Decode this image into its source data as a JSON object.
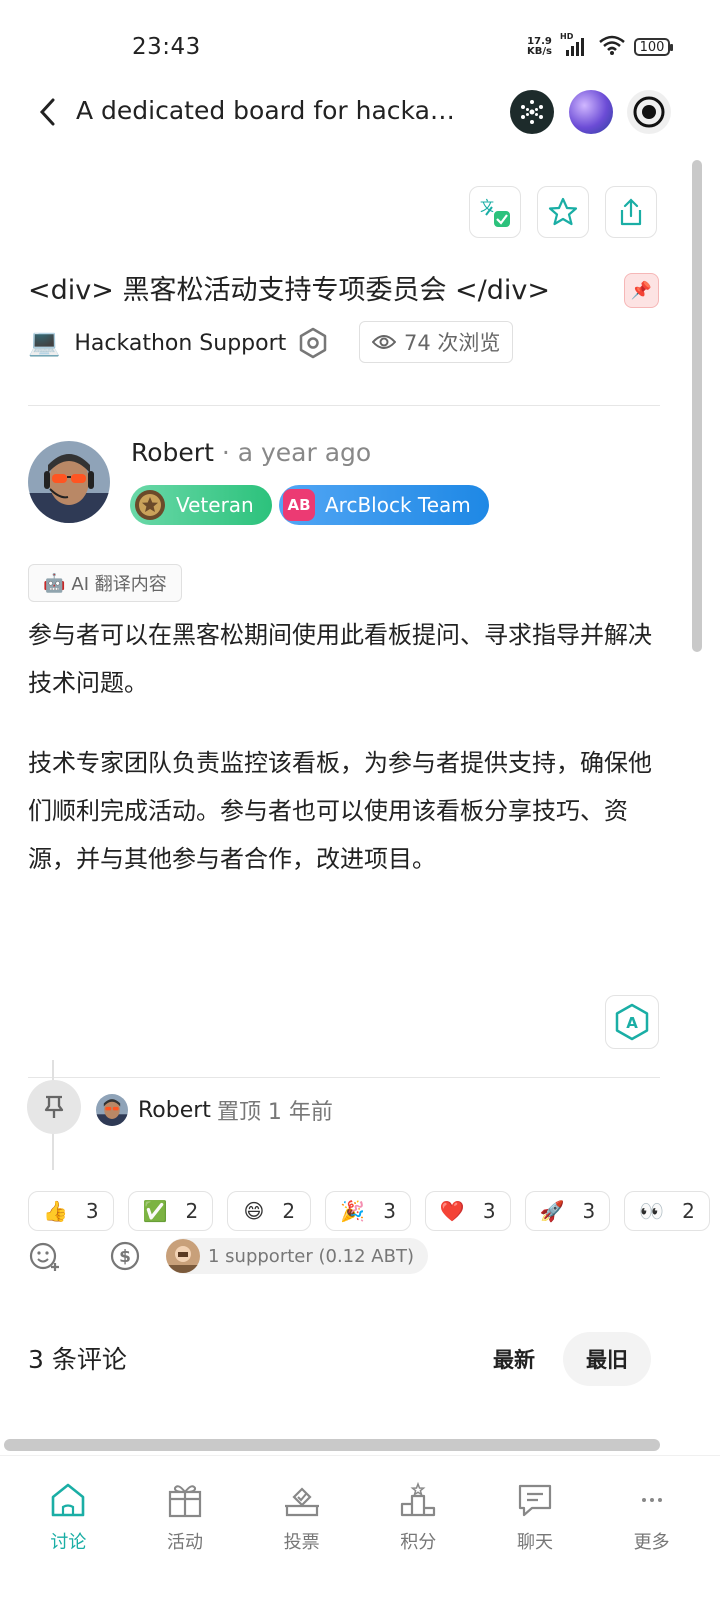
{
  "status_bar": {
    "time": "23:43",
    "net_speed_top": "17.9",
    "net_speed_bottom": "KB/s",
    "signal_label": "HD",
    "battery": "100"
  },
  "header": {
    "title": "A dedicated board for hacka…"
  },
  "post": {
    "title": "<div> 黑客松活动支持专项委员会 </div>",
    "category_icon": "💻",
    "category": "Hackathon Support",
    "views": "74 次浏览",
    "pin_icon": "📌"
  },
  "author": {
    "name": "Robert",
    "time": " · a year ago",
    "badges": [
      {
        "label": "Veteran"
      },
      {
        "label": "ArcBlock Team",
        "icon_text": "AB"
      }
    ]
  },
  "ai_chip": {
    "icon": "🤖",
    "label": "AI 翻译内容"
  },
  "body": {
    "p1": "参与者可以在黑客松期间使用此看板提问、寻求指导并解决技术问题。",
    "p2": "技术专家团队负责监控该看板，为参与者提供支持，确保他们顺利完成活动。参与者也可以使用该看板分享技巧、资源，并与其他参与者合作，改进项目。"
  },
  "timeline": {
    "user": "Robert",
    "action": "置顶 1 年前"
  },
  "reactions": [
    {
      "emoji": "👍",
      "count": "3"
    },
    {
      "emoji": "✅",
      "count": "2"
    },
    {
      "emoji": "😄",
      "count": "2"
    },
    {
      "emoji": "🎉",
      "count": "3"
    },
    {
      "emoji": "❤️",
      "count": "3"
    },
    {
      "emoji": "🚀",
      "count": "3"
    },
    {
      "emoji": "👀",
      "count": "2"
    }
  ],
  "support": {
    "label": "1 supporter (0.12 ABT)"
  },
  "comments": {
    "title": "3 条评论",
    "sort_latest": "最新",
    "sort_oldest": "最旧"
  },
  "nav": [
    {
      "label": "讨论",
      "icon": "home-icon",
      "active": true
    },
    {
      "label": "活动",
      "icon": "gift-icon"
    },
    {
      "label": "投票",
      "icon": "vote-icon"
    },
    {
      "label": "积分",
      "icon": "leaderboard-icon"
    },
    {
      "label": "聊天",
      "icon": "chat-icon"
    },
    {
      "label": "更多",
      "icon": "more-icon"
    }
  ],
  "colors": {
    "accent": "#1aaea5",
    "veteran_badge": "#2cc27c",
    "team_badge": "#1e88e5"
  }
}
